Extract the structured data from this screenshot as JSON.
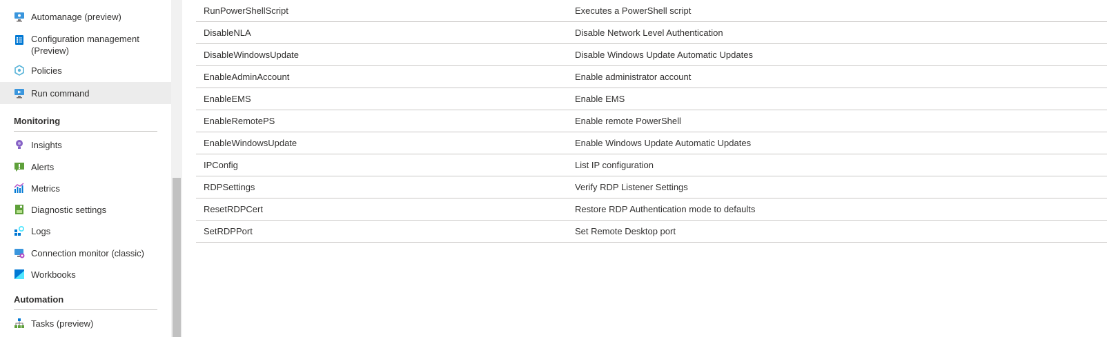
{
  "sidebar": {
    "items_top": [
      {
        "label": "Automanage (preview)",
        "icon": "automanage-icon"
      },
      {
        "label": "Configuration management (Preview)",
        "icon": "configuration-icon"
      },
      {
        "label": "Policies",
        "icon": "policies-icon"
      },
      {
        "label": "Run command",
        "icon": "run-command-icon",
        "active": true
      }
    ],
    "monitoring_header": "Monitoring",
    "monitoring_items": [
      {
        "label": "Insights",
        "icon": "insights-icon"
      },
      {
        "label": "Alerts",
        "icon": "alerts-icon"
      },
      {
        "label": "Metrics",
        "icon": "metrics-icon"
      },
      {
        "label": "Diagnostic settings",
        "icon": "diagnostic-settings-icon"
      },
      {
        "label": "Logs",
        "icon": "logs-icon"
      },
      {
        "label": "Connection monitor (classic)",
        "icon": "connection-monitor-icon"
      },
      {
        "label": "Workbooks",
        "icon": "workbooks-icon"
      }
    ],
    "automation_header": "Automation",
    "automation_items": [
      {
        "label": "Tasks (preview)",
        "icon": "tasks-icon"
      }
    ]
  },
  "commands": [
    {
      "name": "RunPowerShellScript",
      "description": "Executes a PowerShell script"
    },
    {
      "name": "DisableNLA",
      "description": "Disable Network Level Authentication"
    },
    {
      "name": "DisableWindowsUpdate",
      "description": "Disable Windows Update Automatic Updates"
    },
    {
      "name": "EnableAdminAccount",
      "description": "Enable administrator account"
    },
    {
      "name": "EnableEMS",
      "description": "Enable EMS"
    },
    {
      "name": "EnableRemotePS",
      "description": "Enable remote PowerShell"
    },
    {
      "name": "EnableWindowsUpdate",
      "description": "Enable Windows Update Automatic Updates"
    },
    {
      "name": "IPConfig",
      "description": "List IP configuration"
    },
    {
      "name": "RDPSettings",
      "description": "Verify RDP Listener Settings"
    },
    {
      "name": "ResetRDPCert",
      "description": "Restore RDP Authentication mode to defaults"
    },
    {
      "name": "SetRDPPort",
      "description": "Set Remote Desktop port"
    }
  ],
  "colors": {
    "accent_blue": "#0078d4",
    "active_bg": "#ececec",
    "divider": "#c8c6c4"
  }
}
